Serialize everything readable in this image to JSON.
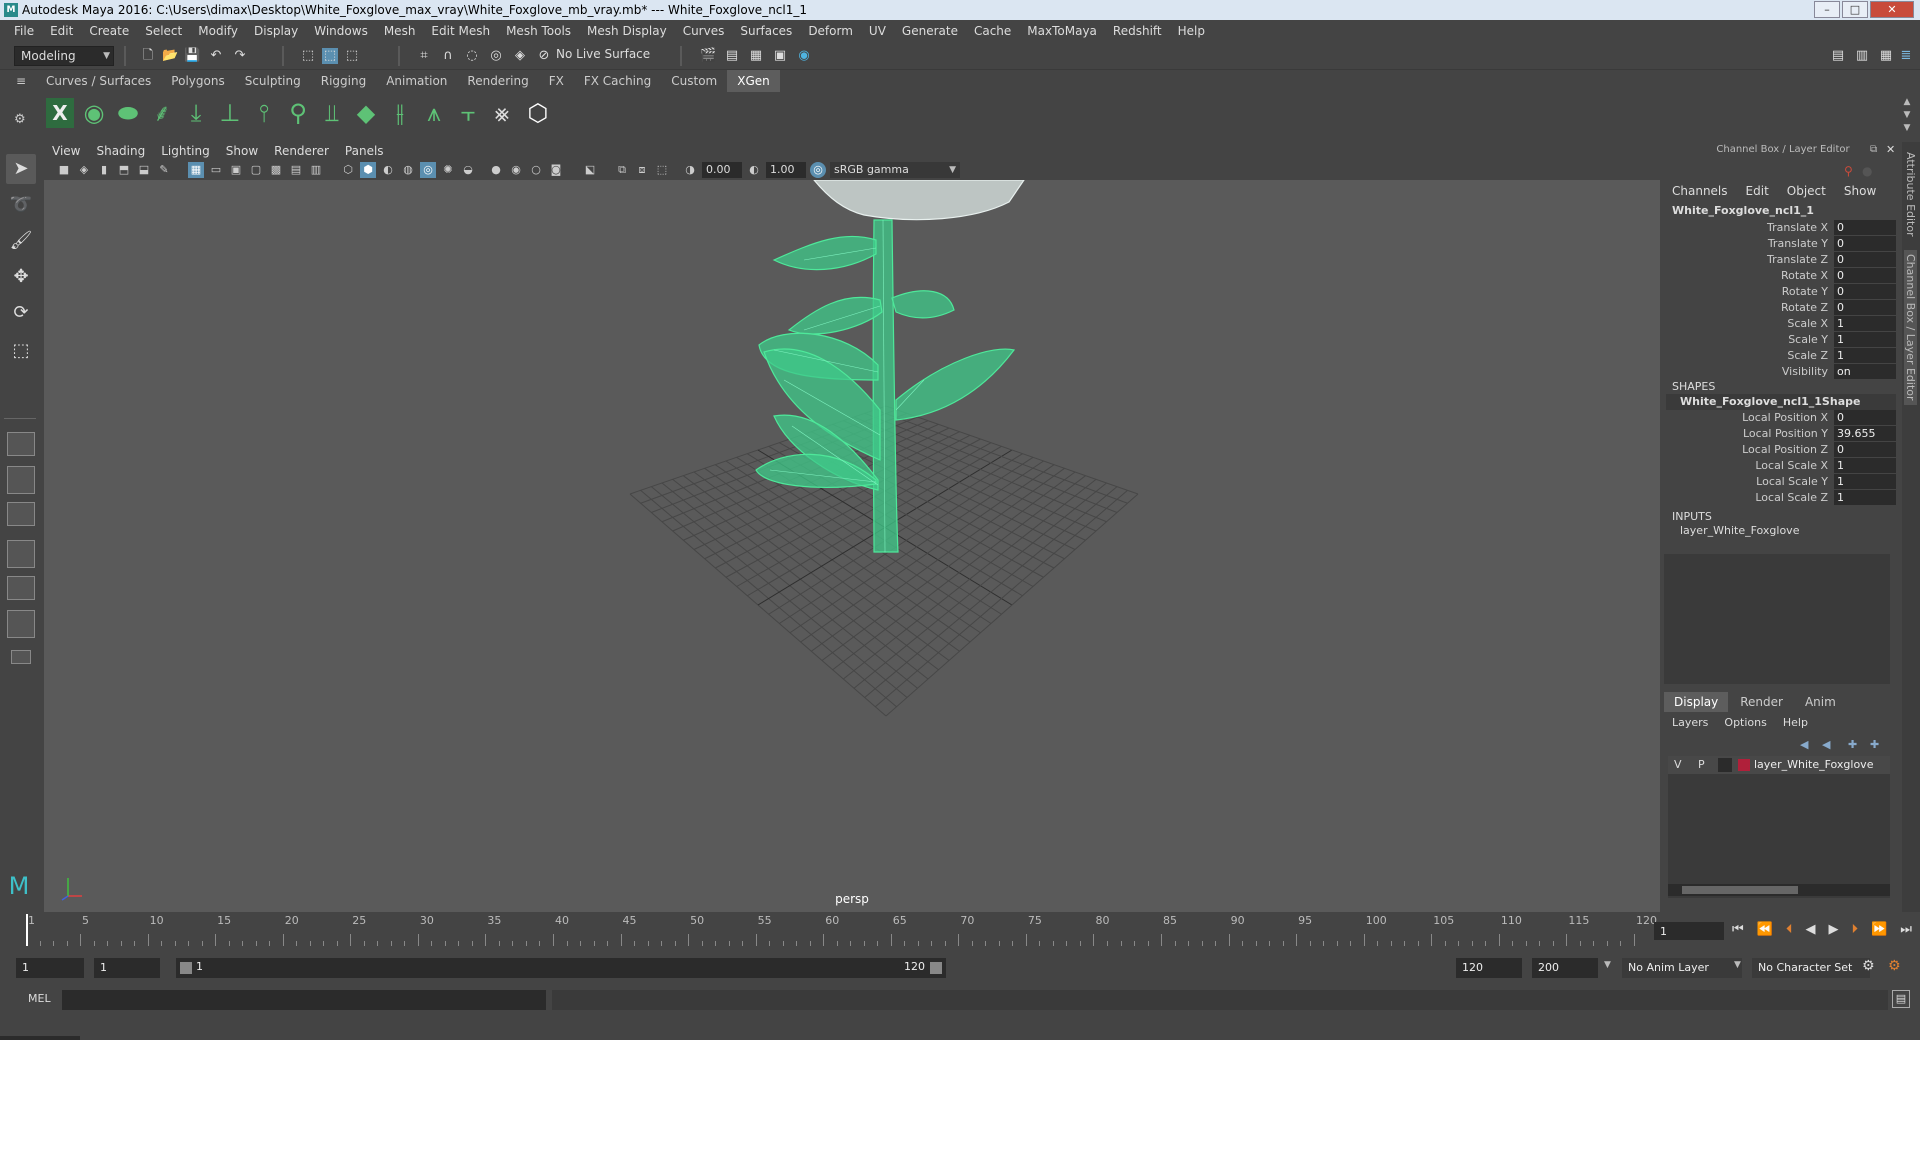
{
  "window": {
    "title": "Autodesk Maya 2016: C:\\Users\\dimax\\Desktop\\White_Foxglove_max_vray\\White_Foxglove_mb_vray.mb*   ---   White_Foxglove_ncl1_1",
    "minimize": "–",
    "maximize": "□",
    "close": "✕"
  },
  "menu": [
    "File",
    "Edit",
    "Create",
    "Select",
    "Modify",
    "Display",
    "Windows",
    "Mesh",
    "Edit Mesh",
    "Mesh Tools",
    "Mesh Display",
    "Curves",
    "Surfaces",
    "Deform",
    "UV",
    "Generate",
    "Cache",
    "MaxToMaya",
    "Redshift",
    "Help"
  ],
  "status": {
    "mode": "Modeling",
    "live_surface": "No Live Surface"
  },
  "shelf": {
    "tabs": [
      "Curves / Surfaces",
      "Polygons",
      "Sculpting",
      "Rigging",
      "Animation",
      "Rendering",
      "FX",
      "FX Caching",
      "Custom",
      "XGen"
    ],
    "active_tab": "XGen"
  },
  "viewport": {
    "menu": [
      "View",
      "Shading",
      "Lighting",
      "Show",
      "Renderer",
      "Panels"
    ],
    "exposure": "0.00",
    "gamma": "1.00",
    "color_space": "sRGB gamma",
    "camera_label": "persp"
  },
  "channel_box": {
    "title": "Channel Box / Layer Editor",
    "menu": [
      "Channels",
      "Edit",
      "Object",
      "Show"
    ],
    "object_name": "White_Foxglove_ncl1_1",
    "channels": [
      {
        "label": "Translate X",
        "value": "0"
      },
      {
        "label": "Translate Y",
        "value": "0"
      },
      {
        "label": "Translate Z",
        "value": "0"
      },
      {
        "label": "Rotate X",
        "value": "0"
      },
      {
        "label": "Rotate Y",
        "value": "0"
      },
      {
        "label": "Rotate Z",
        "value": "0"
      },
      {
        "label": "Scale X",
        "value": "1"
      },
      {
        "label": "Scale Y",
        "value": "1"
      },
      {
        "label": "Scale Z",
        "value": "1"
      },
      {
        "label": "Visibility",
        "value": "on"
      }
    ],
    "shapes_header": "SHAPES",
    "shape_name": "White_Foxglove_ncl1_1Shape",
    "shape_channels": [
      {
        "label": "Local Position X",
        "value": "0"
      },
      {
        "label": "Local Position Y",
        "value": "39.655"
      },
      {
        "label": "Local Position Z",
        "value": "0"
      },
      {
        "label": "Local Scale X",
        "value": "1"
      },
      {
        "label": "Local Scale Y",
        "value": "1"
      },
      {
        "label": "Local Scale Z",
        "value": "1"
      }
    ],
    "inputs_header": "INPUTS",
    "input_name": "layer_White_Foxglove"
  },
  "layer_editor": {
    "tabs": [
      "Display",
      "Render",
      "Anim"
    ],
    "menu": [
      "Layers",
      "Options",
      "Help"
    ],
    "layer": {
      "v": "V",
      "p": "P",
      "name": "layer_White_Foxglove",
      "color": "#b0203a"
    }
  },
  "side_tabs": [
    "Attribute Editor",
    "Channel Box / Layer Editor"
  ],
  "timeline": {
    "labels": [
      "1",
      "5",
      "10",
      "15",
      "20",
      "25",
      "30",
      "35",
      "40",
      "45",
      "50",
      "55",
      "60",
      "65",
      "70",
      "75",
      "80",
      "85",
      "90",
      "95",
      "100",
      "105",
      "110",
      "115",
      "120"
    ],
    "current_frame": "1"
  },
  "range": {
    "start": "1",
    "playback_start": "1",
    "slider_start": "1",
    "slider_end": "120",
    "playback_end": "120",
    "end": "200",
    "anim_layer": "No Anim Layer",
    "character_set": "No Character Set"
  },
  "command_line": {
    "label": "MEL"
  },
  "accent_color": "#5ec276",
  "wireframe_color": "#4ee89a"
}
